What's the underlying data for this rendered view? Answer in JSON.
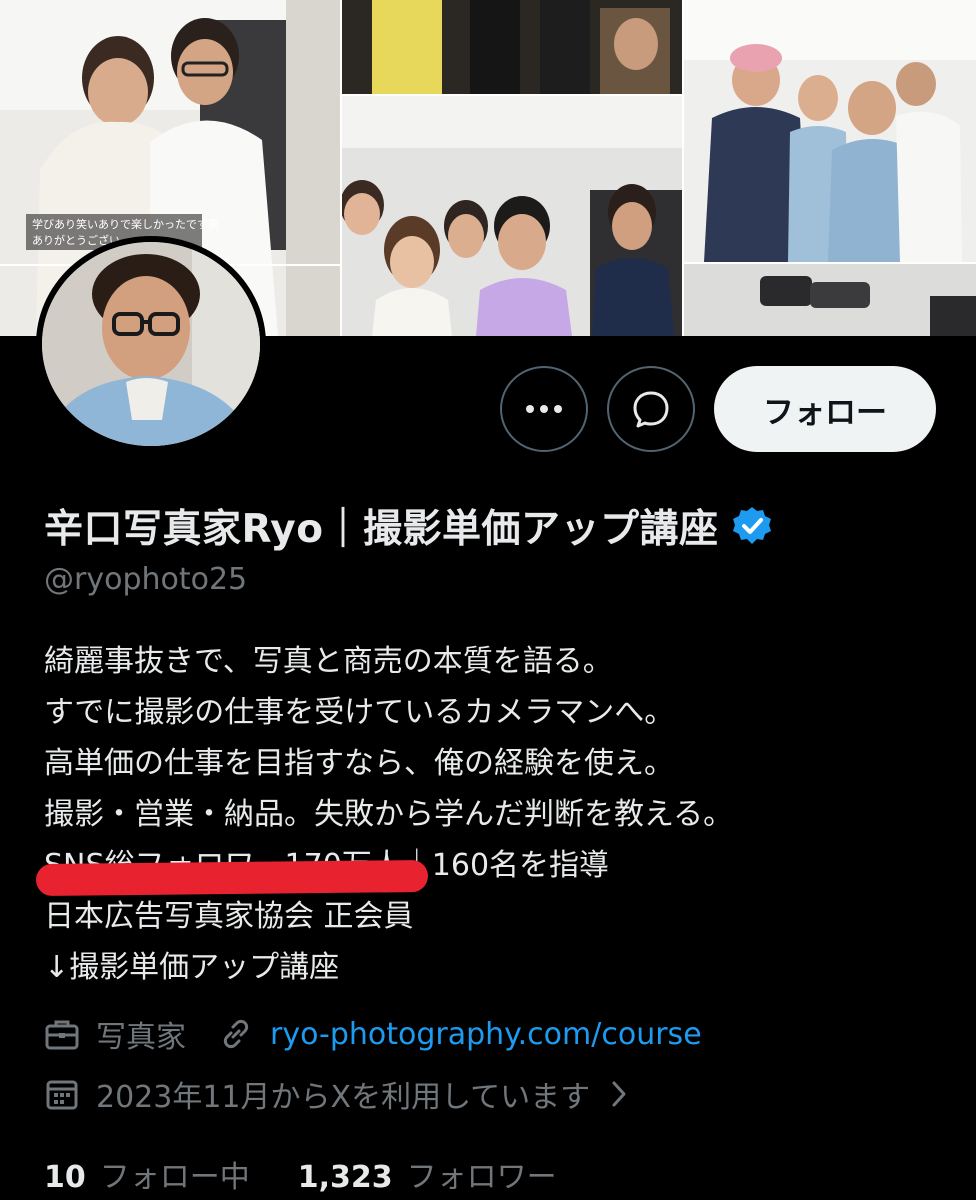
{
  "banner": {
    "caption_lines": [
      "学びあり笑いありで楽しかったです笑",
      "ありがとうござい"
    ]
  },
  "profile": {
    "display_name": "辛口写真家Ryo｜撮影単価アップ講座",
    "handle": "@ryophoto25",
    "verified": true,
    "bio_lines": [
      "綺麗事抜きで、写真と商売の本質を語る。",
      "すでに撮影の仕事を受けているカメラマンへ。",
      "高単価の仕事を目指すなら、俺の経験を使え。",
      "撮影・営業・納品。失敗から学んだ判断を教える。",
      "SNS総フォロワー170万人｜160名を指導",
      "日本広告写真家協会 正会員",
      "↓撮影単価アップ講座"
    ]
  },
  "actions": {
    "more_icon": "more-horizontal-icon",
    "message_icon": "message-bubble-icon",
    "follow_label": "フォロー"
  },
  "meta": {
    "profession": "写真家",
    "profession_icon": "briefcase-icon",
    "link": "ryo-photography.com/course",
    "link_icon": "link-icon",
    "joined": "2023年11月からXを利用しています",
    "joined_icon": "calendar-icon"
  },
  "counts": {
    "following_num": "10",
    "following_label": "フォロー中",
    "followers_num": "1,323",
    "followers_label": "フォロワー"
  },
  "colors": {
    "background": "#000000",
    "text_primary": "#e7e9ea",
    "text_secondary": "#71767b",
    "link": "#1d9bf0",
    "verified_badge": "#1d9bf0",
    "follow_button_bg": "#eff3f4",
    "redaction": "#e8232f"
  }
}
